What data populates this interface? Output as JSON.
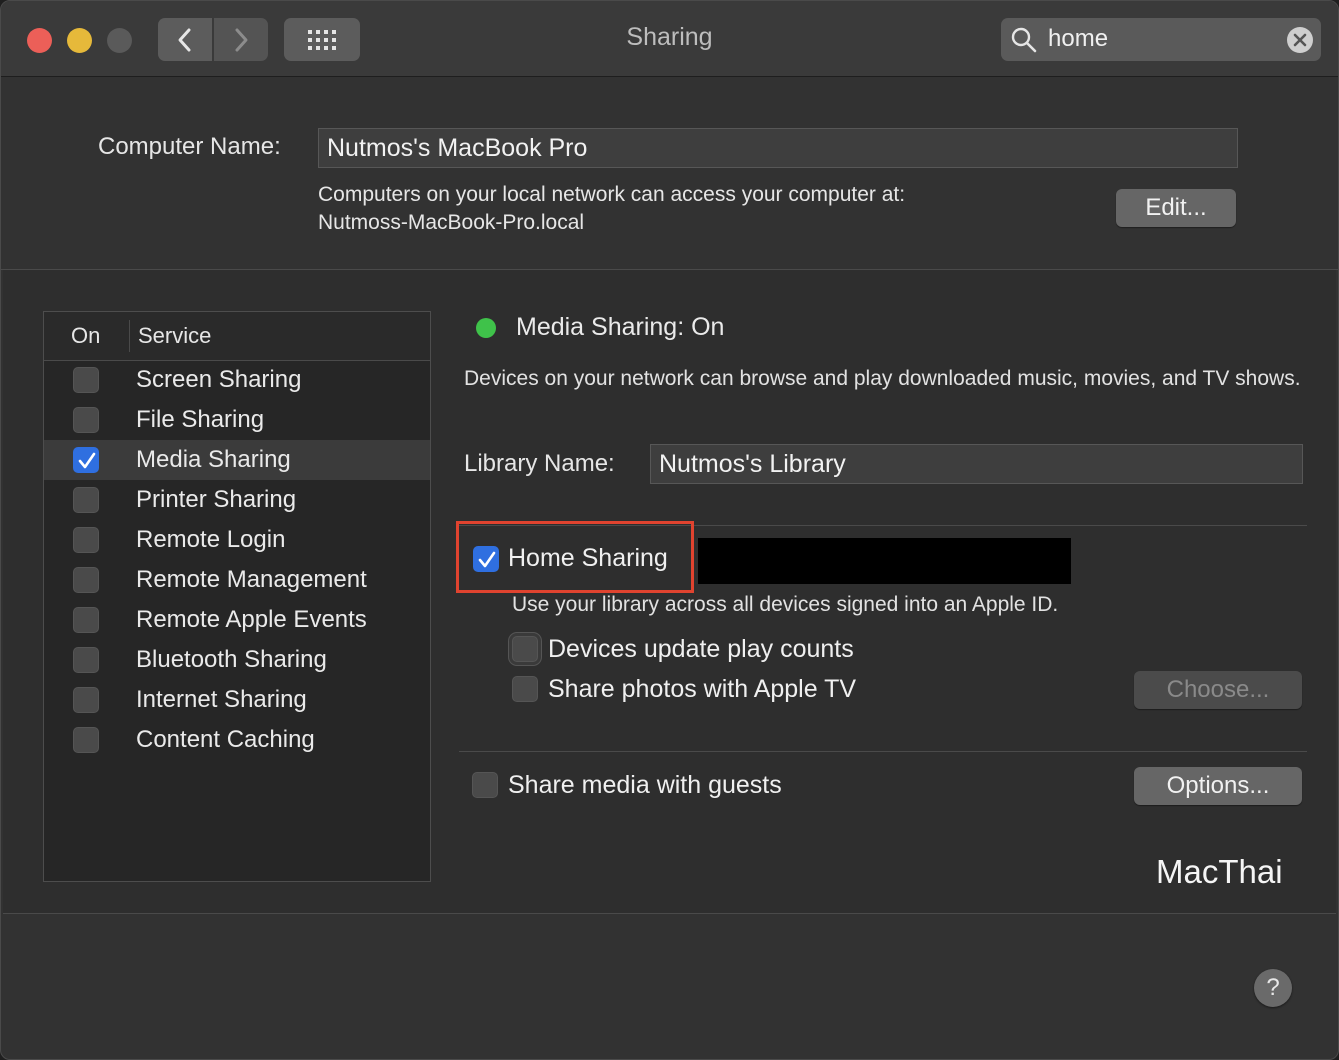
{
  "window": {
    "title": "Sharing",
    "search_value": "home",
    "icons": {
      "back": "chevron-left-icon",
      "forward": "chevron-right-icon",
      "grid": "grid-icon",
      "search": "search-icon",
      "clear": "clear-icon"
    }
  },
  "computer": {
    "name_label": "Computer Name:",
    "name_value": "Nutmos's MacBook Pro",
    "network_line1": "Computers on your local network can access your computer at:",
    "network_line2": "Nutmoss-MacBook-Pro.local",
    "edit_label": "Edit..."
  },
  "service_list": {
    "header_on": "On",
    "header_service": "Service",
    "items": [
      {
        "label": "Screen Sharing",
        "checked": false,
        "selected": false
      },
      {
        "label": "File Sharing",
        "checked": false,
        "selected": false
      },
      {
        "label": "Media Sharing",
        "checked": true,
        "selected": true
      },
      {
        "label": "Printer Sharing",
        "checked": false,
        "selected": false
      },
      {
        "label": "Remote Login",
        "checked": false,
        "selected": false
      },
      {
        "label": "Remote Management",
        "checked": false,
        "selected": false
      },
      {
        "label": "Remote Apple Events",
        "checked": false,
        "selected": false
      },
      {
        "label": "Bluetooth Sharing",
        "checked": false,
        "selected": false
      },
      {
        "label": "Internet Sharing",
        "checked": false,
        "selected": false
      },
      {
        "label": "Content Caching",
        "checked": false,
        "selected": false
      }
    ]
  },
  "detail": {
    "status": "Media Sharing: On",
    "status_color": "#3fc24a",
    "description": "Devices on your network can browse and play downloaded music, movies, and TV shows.",
    "library_label": "Library Name:",
    "library_value": "Nutmos's Library",
    "home_sharing_label": "Home Sharing",
    "home_sharing_checked": true,
    "home_sharing_desc": "Use your library across all devices signed into an Apple ID.",
    "update_play_counts_label": "Devices update play counts",
    "update_play_counts_checked": false,
    "share_photos_label": "Share photos with Apple TV",
    "share_photos_checked": false,
    "choose_label": "Choose...",
    "guests_label": "Share media with guests",
    "guests_checked": false,
    "options_label": "Options..."
  },
  "watermark": "MacThai",
  "help_label": "?",
  "colors": {
    "accent": "#2f6fe0",
    "highlight": "#e0432f",
    "close": "#ec5f58",
    "minimize": "#e6b93a"
  }
}
